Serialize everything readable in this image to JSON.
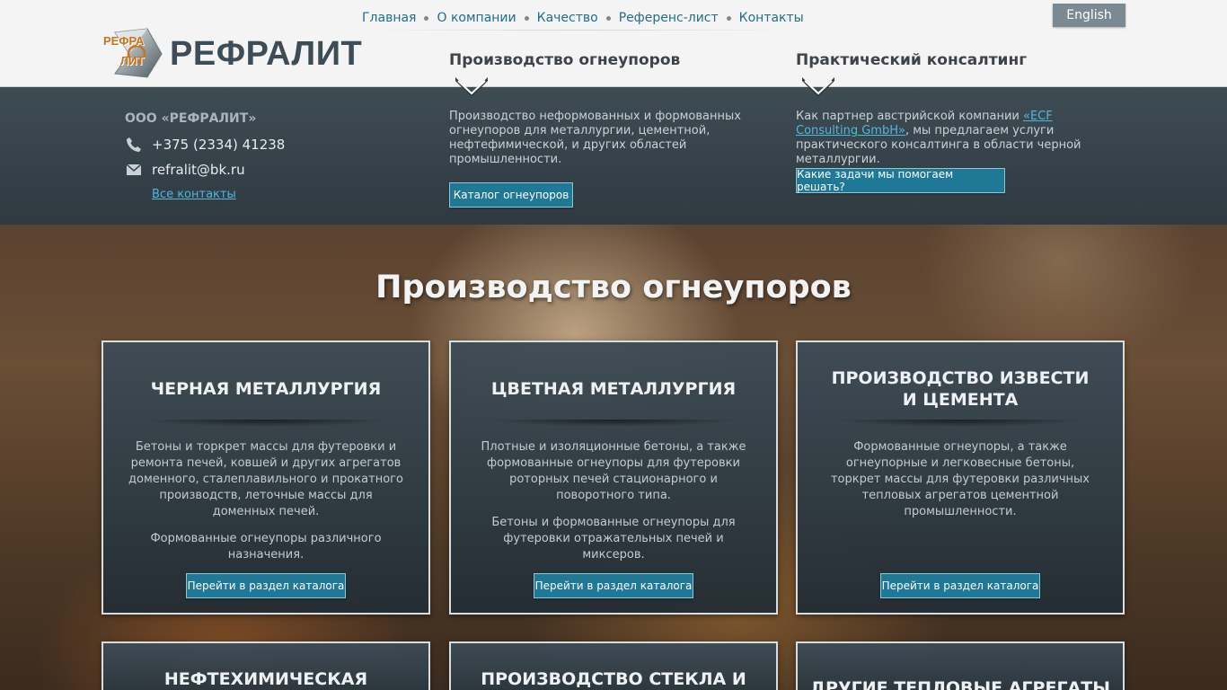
{
  "header": {
    "logo_top": "РЕФРА",
    "logo_bottom": "ЛИТ",
    "brand": "РЕФРАЛИТ",
    "nav": [
      "Главная",
      "О компании",
      "Качество",
      "Референс-лист",
      "Контакты"
    ],
    "lang_button": "English",
    "col1_heading": "Производство огнеупоров",
    "col2_heading": "Практический консалтинг"
  },
  "contacts": {
    "company": "ООО «РЕФРАЛИТ»",
    "phone": "+375 (2334) 41238",
    "email": "refralit@bk.ru",
    "all_contacts": "Все контакты"
  },
  "production": {
    "text": "Производство неформованных и формованных огнеупоров для металлургии, цементной, нефтефимической, и других областей промышленности.",
    "button": "Каталог огнеупоров"
  },
  "consulting": {
    "text_before": "Как партнер австрийской компании ",
    "link": "«ECF Consulting GmbH»",
    "text_after": ", мы предлагаем услуги практического консалтинга в области черной металлургии.",
    "button": "Какие задачи мы помогаем решать?"
  },
  "hero": {
    "title": "Производство огнеупоров"
  },
  "cards": [
    {
      "title": "ЧЕРНАЯ МЕТАЛЛУРГИЯ",
      "p1": "Бетоны и торкрет массы для футеровки и ремонта печей, ковшей и других агрегатов доменного, сталеплавильного и прокатного производств, леточные массы для доменных печей.",
      "p2": "Формованные огнеупоры различного назначения.",
      "button": "Перейти в раздел каталога"
    },
    {
      "title": "ЦВЕТНАЯ МЕТАЛЛУРГИЯ",
      "p1": "Плотные и изоляционные бетоны, а также формованные огнеупоры для футеровки роторных печей стационарного и поворотного типа.",
      "p2": "Бетоны и формованные огнеупоры для футеровки отражательных печей и миксеров.",
      "button": "Перейти в раздел каталога"
    },
    {
      "title_line1": "ПРОИЗВОДСТВО ИЗВЕСТИ",
      "title_line2": "И ЦЕМЕНТА",
      "p1": "Формованные огнеупоры, а также огнеупорные и легковесные бетоны, торкрет массы для футеровки различных тепловых агрегатов цементной промышленности.",
      "button": "Перейти в раздел каталога"
    }
  ],
  "cards_row2": [
    {
      "title": "НЕФТЕХИМИЧЕСКАЯ"
    },
    {
      "title": "ПРОИЗВОДСТВО СТЕКЛА И"
    },
    {
      "title": "ДРУГИЕ ТЕПЛОВЫЕ АГРЕГАТЫ"
    }
  ],
  "colors": {
    "brand_text": "#3d4d57",
    "nav_link": "#1f6e8c",
    "button": "#1f7896",
    "link_light": "#4fb8e0",
    "logo_accent": "#c8741b"
  }
}
